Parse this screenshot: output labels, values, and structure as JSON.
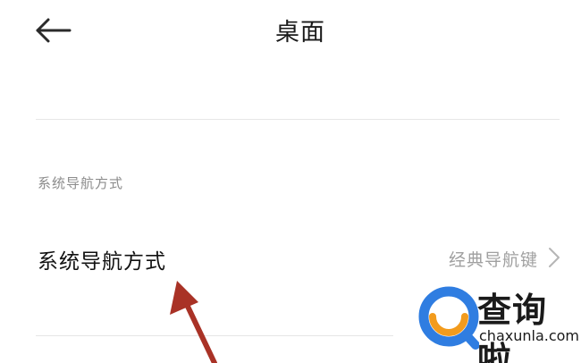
{
  "header": {
    "title": "桌面",
    "back_icon": "arrow-left-icon"
  },
  "section": {
    "header": "系统导航方式"
  },
  "setting": {
    "label": "系统导航方式",
    "value": "经典导航键",
    "chevron_icon": "chevron-right-icon"
  },
  "annotation": {
    "arrow_color": "#a93226"
  },
  "watermark": {
    "brand_cn": "查询啦",
    "brand_en": "chaxunla.com",
    "logo_icon": "magnifier-logo-icon",
    "colors": {
      "blue": "#2f7de1",
      "orange": "#f29b1d",
      "text": "#1a1a1a"
    }
  }
}
